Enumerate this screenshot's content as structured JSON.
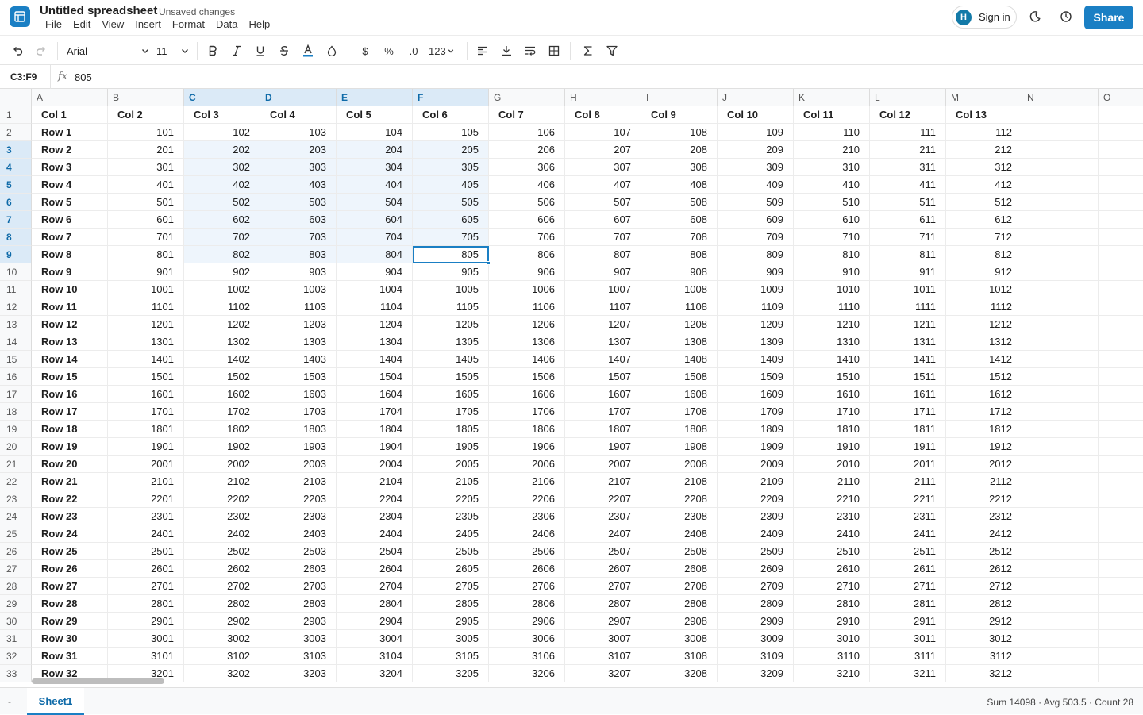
{
  "app": {
    "title": "Untitled spreadsheet",
    "status": "Unsaved changes",
    "menu": [
      "File",
      "Edit",
      "View",
      "Insert",
      "Format",
      "Data",
      "Help"
    ],
    "signin_label": "Sign in",
    "avatar_initial": "H",
    "share_label": "Share",
    "accent_color": "#1a7fc4"
  },
  "toolbar": {
    "font": "Arial",
    "size": "11",
    "currency": "$",
    "percent": "%",
    "decimal": ".0",
    "number_format": "123"
  },
  "formula": {
    "range": "C3:F9",
    "fx": "fx",
    "value": "805"
  },
  "grid": {
    "columns": [
      "A",
      "B",
      "C",
      "D",
      "E",
      "F",
      "G",
      "H",
      "I",
      "J",
      "K",
      "L",
      "M",
      "N",
      "O"
    ],
    "selected_columns": [
      "C",
      "D",
      "E",
      "F"
    ],
    "selected_rows": [
      3,
      4,
      5,
      6,
      7,
      8,
      9
    ],
    "active_cell": "F9",
    "header_row": [
      "Col 1",
      "Col 2",
      "Col 3",
      "Col 4",
      "Col 5",
      "Col 6",
      "Col 7",
      "Col 8",
      "Col 9",
      "Col 10",
      "Col 11",
      "Col 12",
      "Col 13",
      "",
      ""
    ],
    "row_labels": [
      "Row 1",
      "Row 2",
      "Row 3",
      "Row 4",
      "Row 5",
      "Row 6",
      "Row 7",
      "Row 8",
      "Row 9",
      "Row 10",
      "Row 11",
      "Row 12",
      "Row 13",
      "Row 14",
      "Row 15",
      "Row 16",
      "Row 17",
      "Row 18",
      "Row 19",
      "Row 20",
      "Row 21",
      "Row 22",
      "Row 23",
      "Row 24",
      "Row 25",
      "Row 26",
      "Row 27",
      "Row 28",
      "Row 29",
      "Row 30",
      "Row 31",
      "Row 32"
    ],
    "rows": [
      [
        "101",
        "102",
        "103",
        "104",
        "105",
        "106",
        "107",
        "108",
        "109",
        "110",
        "111",
        "112"
      ],
      [
        "201",
        "202",
        "203",
        "204",
        "205",
        "206",
        "207",
        "208",
        "209",
        "210",
        "211",
        "212"
      ],
      [
        "301",
        "302",
        "303",
        "304",
        "305",
        "306",
        "307",
        "308",
        "309",
        "310",
        "311",
        "312"
      ],
      [
        "401",
        "402",
        "403",
        "404",
        "405",
        "406",
        "407",
        "408",
        "409",
        "410",
        "411",
        "412"
      ],
      [
        "501",
        "502",
        "503",
        "504",
        "505",
        "506",
        "507",
        "508",
        "509",
        "510",
        "511",
        "512"
      ],
      [
        "601",
        "602",
        "603",
        "604",
        "605",
        "606",
        "607",
        "608",
        "609",
        "610",
        "611",
        "612"
      ],
      [
        "701",
        "702",
        "703",
        "704",
        "705",
        "706",
        "707",
        "708",
        "709",
        "710",
        "711",
        "712"
      ],
      [
        "801",
        "802",
        "803",
        "804",
        "805",
        "806",
        "807",
        "808",
        "809",
        "810",
        "811",
        "812"
      ],
      [
        "901",
        "902",
        "903",
        "904",
        "905",
        "906",
        "907",
        "908",
        "909",
        "910",
        "911",
        "912"
      ],
      [
        "1001",
        "1002",
        "1003",
        "1004",
        "1005",
        "1006",
        "1007",
        "1008",
        "1009",
        "1010",
        "1011",
        "1012"
      ],
      [
        "1101",
        "1102",
        "1103",
        "1104",
        "1105",
        "1106",
        "1107",
        "1108",
        "1109",
        "1110",
        "1111",
        "1112"
      ],
      [
        "1201",
        "1202",
        "1203",
        "1204",
        "1205",
        "1206",
        "1207",
        "1208",
        "1209",
        "1210",
        "1211",
        "1212"
      ],
      [
        "1301",
        "1302",
        "1303",
        "1304",
        "1305",
        "1306",
        "1307",
        "1308",
        "1309",
        "1310",
        "1311",
        "1312"
      ],
      [
        "1401",
        "1402",
        "1403",
        "1404",
        "1405",
        "1406",
        "1407",
        "1408",
        "1409",
        "1410",
        "1411",
        "1412"
      ],
      [
        "1501",
        "1502",
        "1503",
        "1504",
        "1505",
        "1506",
        "1507",
        "1508",
        "1509",
        "1510",
        "1511",
        "1512"
      ],
      [
        "1601",
        "1602",
        "1603",
        "1604",
        "1605",
        "1606",
        "1607",
        "1608",
        "1609",
        "1610",
        "1611",
        "1612"
      ],
      [
        "1701",
        "1702",
        "1703",
        "1704",
        "1705",
        "1706",
        "1707",
        "1708",
        "1709",
        "1710",
        "1711",
        "1712"
      ],
      [
        "1801",
        "1802",
        "1803",
        "1804",
        "1805",
        "1806",
        "1807",
        "1808",
        "1809",
        "1810",
        "1811",
        "1812"
      ],
      [
        "1901",
        "1902",
        "1903",
        "1904",
        "1905",
        "1906",
        "1907",
        "1908",
        "1909",
        "1910",
        "1911",
        "1912"
      ],
      [
        "2001",
        "2002",
        "2003",
        "2004",
        "2005",
        "2006",
        "2007",
        "2008",
        "2009",
        "2010",
        "2011",
        "2012"
      ],
      [
        "2101",
        "2102",
        "2103",
        "2104",
        "2105",
        "2106",
        "2107",
        "2108",
        "2109",
        "2110",
        "2111",
        "2112"
      ],
      [
        "2201",
        "2202",
        "2203",
        "2204",
        "2205",
        "2206",
        "2207",
        "2208",
        "2209",
        "2210",
        "2211",
        "2212"
      ],
      [
        "2301",
        "2302",
        "2303",
        "2304",
        "2305",
        "2306",
        "2307",
        "2308",
        "2309",
        "2310",
        "2311",
        "2312"
      ],
      [
        "2401",
        "2402",
        "2403",
        "2404",
        "2405",
        "2406",
        "2407",
        "2408",
        "2409",
        "2410",
        "2411",
        "2412"
      ],
      [
        "2501",
        "2502",
        "2503",
        "2504",
        "2505",
        "2506",
        "2507",
        "2508",
        "2509",
        "2510",
        "2511",
        "2512"
      ],
      [
        "2601",
        "2602",
        "2603",
        "2604",
        "2605",
        "2606",
        "2607",
        "2608",
        "2609",
        "2610",
        "2611",
        "2612"
      ],
      [
        "2701",
        "2702",
        "2703",
        "2704",
        "2705",
        "2706",
        "2707",
        "2708",
        "2709",
        "2710",
        "2711",
        "2712"
      ],
      [
        "2801",
        "2802",
        "2803",
        "2804",
        "2805",
        "2806",
        "2807",
        "2808",
        "2809",
        "2810",
        "2811",
        "2812"
      ],
      [
        "2901",
        "2902",
        "2903",
        "2904",
        "2905",
        "2906",
        "2907",
        "2908",
        "2909",
        "2910",
        "2911",
        "2912"
      ],
      [
        "3001",
        "3002",
        "3003",
        "3004",
        "3005",
        "3006",
        "3007",
        "3008",
        "3009",
        "3010",
        "3011",
        "3012"
      ],
      [
        "3101",
        "3102",
        "3103",
        "3104",
        "3105",
        "3106",
        "3107",
        "3108",
        "3109",
        "3110",
        "3111",
        "3112"
      ],
      [
        "3201",
        "3202",
        "3203",
        "3204",
        "3205",
        "3206",
        "3207",
        "3208",
        "3209",
        "3210",
        "3211",
        "3212"
      ]
    ]
  },
  "footer": {
    "add_sheet": "-",
    "sheet_tab": "Sheet1",
    "stats": "Sum 14098 · Avg 503.5 · Count 28"
  },
  "icons": {
    "app_logo": "spreadsheet-logo-icon",
    "theme": "moon-icon",
    "history": "clock-icon"
  }
}
